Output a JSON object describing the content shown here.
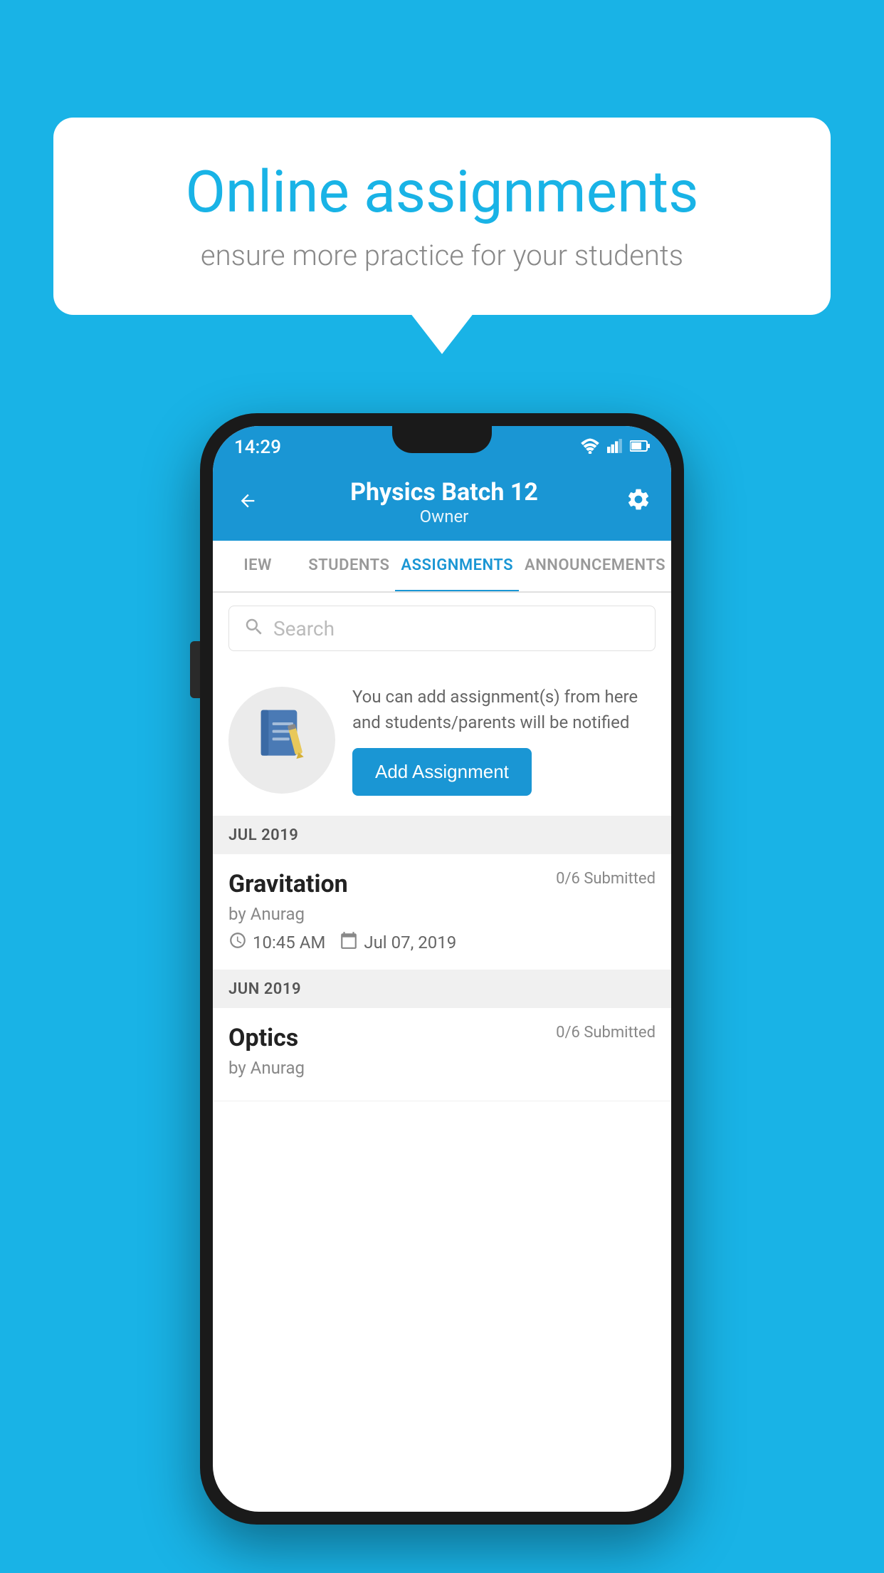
{
  "background_color": "#19b3e6",
  "speech_bubble": {
    "title": "Online assignments",
    "subtitle": "ensure more practice for your students"
  },
  "status_bar": {
    "time": "14:29",
    "wifi": "▼",
    "signal": "▲",
    "battery": "▐"
  },
  "header": {
    "title": "Physics Batch 12",
    "subtitle": "Owner",
    "back_label": "←",
    "settings_label": "⚙"
  },
  "tabs": [
    {
      "label": "IEW",
      "active": false
    },
    {
      "label": "STUDENTS",
      "active": false
    },
    {
      "label": "ASSIGNMENTS",
      "active": true
    },
    {
      "label": "ANNOUNCEMENTS",
      "active": false
    }
  ],
  "search": {
    "placeholder": "Search"
  },
  "promo": {
    "text": "You can add assignment(s) from here and students/parents will be notified",
    "button_label": "Add Assignment"
  },
  "sections": [
    {
      "label": "JUL 2019",
      "assignments": [
        {
          "name": "Gravitation",
          "submitted": "0/6 Submitted",
          "by": "by Anurag",
          "time": "10:45 AM",
          "date": "Jul 07, 2019"
        }
      ]
    },
    {
      "label": "JUN 2019",
      "assignments": [
        {
          "name": "Optics",
          "submitted": "0/6 Submitted",
          "by": "by Anurag",
          "time": "",
          "date": ""
        }
      ]
    }
  ]
}
